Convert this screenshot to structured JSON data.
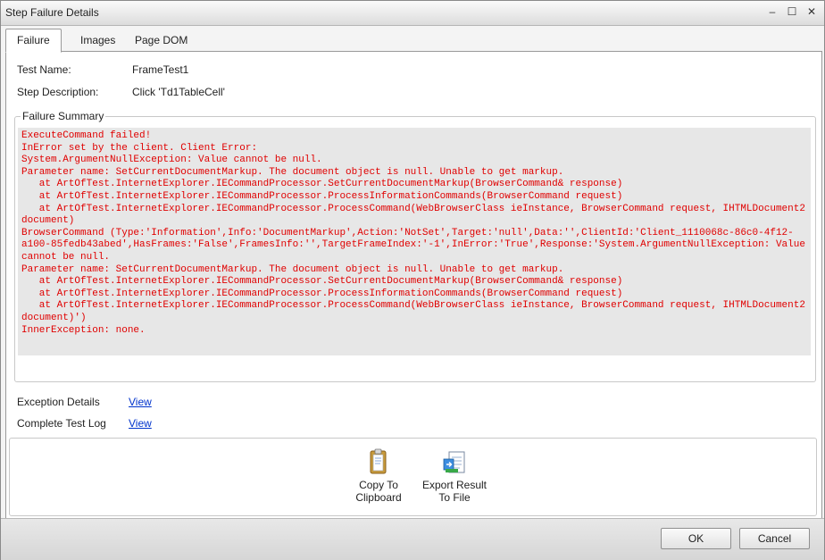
{
  "window": {
    "title": "Step Failure Details",
    "minimize": "–",
    "maximize": "☐",
    "close": "✕"
  },
  "tabs": [
    {
      "label": "Failure",
      "active": true
    },
    {
      "label": "Images",
      "active": false
    },
    {
      "label": "Page DOM",
      "active": false
    }
  ],
  "details": {
    "test_name_label": "Test Name:",
    "test_name_value": "FrameTest1",
    "step_desc_label": "Step Description:",
    "step_desc_value": "Click 'Td1TableCell'"
  },
  "failure_summary": {
    "legend": "Failure Summary",
    "text_color": "#e00000",
    "text": "ExecuteCommand failed!\nInError set by the client. Client Error:\nSystem.ArgumentNullException: Value cannot be null.\nParameter name: SetCurrentDocumentMarkup. The document object is null. Unable to get markup.\n   at ArtOfTest.InternetExplorer.IECommandProcessor.SetCurrentDocumentMarkup(BrowserCommand& response)\n   at ArtOfTest.InternetExplorer.IECommandProcessor.ProcessInformationCommands(BrowserCommand request)\n   at ArtOfTest.InternetExplorer.IECommandProcessor.ProcessCommand(WebBrowserClass ieInstance, BrowserCommand request, IHTMLDocument2\ndocument)\nBrowserCommand (Type:'Information',Info:'DocumentMarkup',Action:'NotSet',Target:'null',Data:'',ClientId:'Client_1110068c-86c0-4f12-\na100-85fedb43abed',HasFrames:'False',FramesInfo:'',TargetFrameIndex:'-1',InError:'True',Response:'System.ArgumentNullException: Value\ncannot be null.\nParameter name: SetCurrentDocumentMarkup. The document object is null. Unable to get markup.\n   at ArtOfTest.InternetExplorer.IECommandProcessor.SetCurrentDocumentMarkup(BrowserCommand& response)\n   at ArtOfTest.InternetExplorer.IECommandProcessor.ProcessInformationCommands(BrowserCommand request)\n   at ArtOfTest.InternetExplorer.IECommandProcessor.ProcessCommand(WebBrowserClass ieInstance, BrowserCommand request, IHTMLDocument2\ndocument)')\nInnerException: none."
  },
  "links": {
    "exception_label": "Exception Details",
    "exception_link": "View",
    "log_label": "Complete Test Log",
    "log_link": "View"
  },
  "toolbar": {
    "copy_line1": "Copy To",
    "copy_line2": "Clipboard",
    "copy_icon": "clipboard-icon",
    "export_line1": "Export Result",
    "export_line2": "To File",
    "export_icon": "export-file-icon"
  },
  "footer": {
    "ok": "OK",
    "cancel": "Cancel"
  }
}
